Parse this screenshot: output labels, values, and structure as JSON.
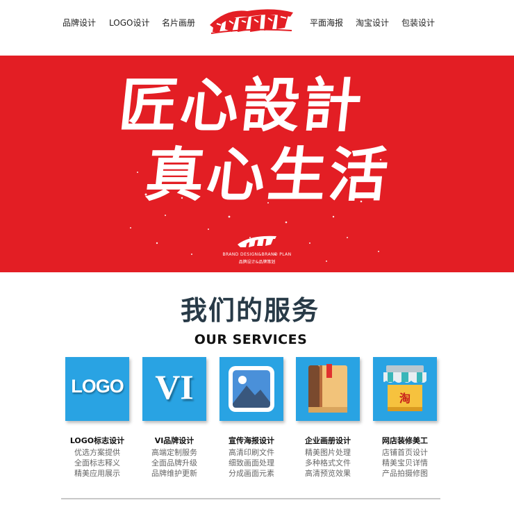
{
  "nav": {
    "left": [
      "品牌设计",
      "LOGO设计",
      "名片画册"
    ],
    "right": [
      "平面海报",
      "淘宝设计",
      "包装设计"
    ]
  },
  "hero": {
    "headline_line1": "匠心設計",
    "headline_line2": "真心生活",
    "tagline_en": "BRAND DESIGN&BRAND PLAN",
    "tagline_cn": "品牌设计&品牌策划"
  },
  "services": {
    "title": "我们的服务",
    "subtitle": "OUR SERVICES",
    "items": [
      {
        "icon_text": "LOGO",
        "icon": "logo-text-icon",
        "title": "LOGO标志设计",
        "lines": [
          "优选方案提供",
          "全面标志释义",
          "精美应用展示"
        ]
      },
      {
        "icon_text": "VI",
        "icon": "vi-text-icon",
        "title": "VI品牌设计",
        "lines": [
          "高端定制服务",
          "全面品牌升级",
          "品牌维护更新"
        ]
      },
      {
        "icon_text": "",
        "icon": "picture-icon",
        "title": "宣传海报设计",
        "lines": [
          "高清印刷文件",
          "细致画面处理",
          "分成画面元素"
        ]
      },
      {
        "icon_text": "",
        "icon": "book-icon",
        "title": "企业画册设计",
        "lines": [
          "精美图片处理",
          "多种格式文件",
          "高清预览效果"
        ]
      },
      {
        "icon_text": "淘",
        "icon": "shop-icon",
        "title": "网店装修美工",
        "lines": [
          "店铺首页设计",
          "精美宝贝详情",
          "产品拍摄修图"
        ]
      }
    ]
  },
  "colors": {
    "hero_red": "#e31e24",
    "card_blue": "#29a3e3",
    "title_dark": "#283a47"
  }
}
